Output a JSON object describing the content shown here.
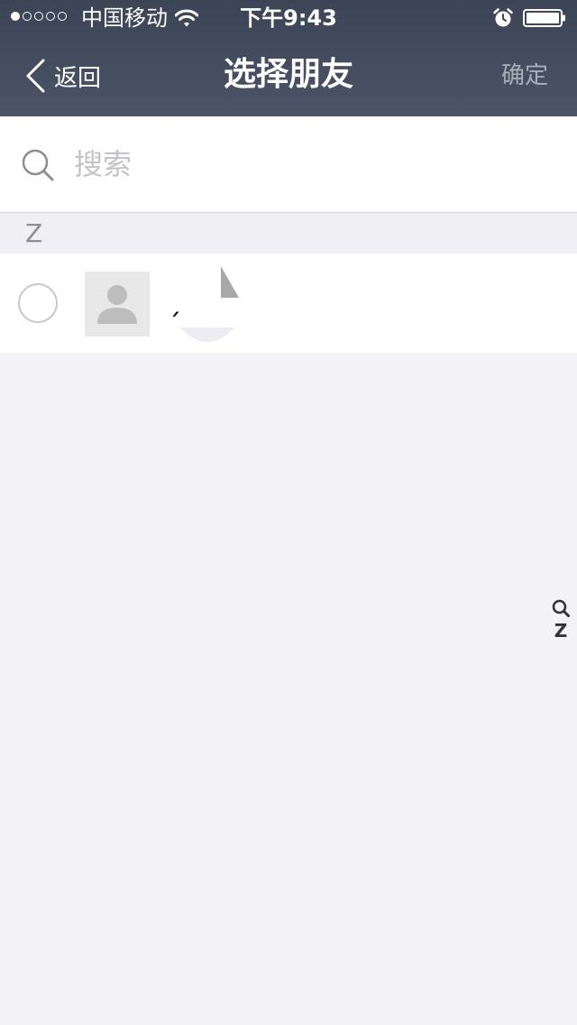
{
  "status_bar": {
    "carrier": "中国移动",
    "time": "下午9:43",
    "signal_bars_filled": 1,
    "signal_bars_total": 5,
    "battery_level": 1.0
  },
  "nav": {
    "back_label": "返回",
    "title": "选择朋友",
    "confirm_label": "确定"
  },
  "search": {
    "placeholder": "搜索",
    "value": ""
  },
  "sections": [
    {
      "letter": "Z",
      "contacts": [
        {
          "name": "ˏ",
          "selected": false
        }
      ]
    }
  ],
  "index_bar": {
    "letters": [
      "Z"
    ]
  },
  "colors": {
    "nav_background": "#3c4556",
    "page_background": "#f2f2f7",
    "confirm_disabled": "#a9afba",
    "placeholder": "#c4c4c8"
  },
  "icons": {
    "back": "chevron-left-icon",
    "search": "search-icon",
    "wifi": "wifi-icon",
    "alarm": "alarm-icon",
    "battery": "battery-icon",
    "avatar": "default-avatar-icon"
  }
}
